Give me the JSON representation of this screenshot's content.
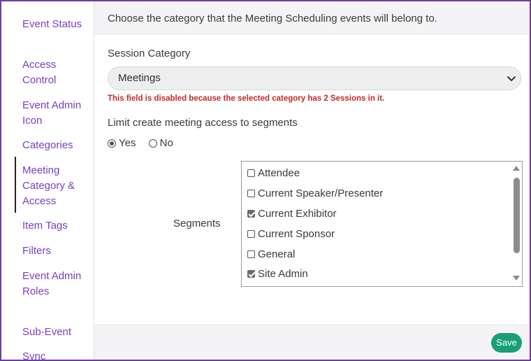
{
  "sidebar": {
    "items": [
      {
        "label": "Event Status"
      },
      {
        "label": "Access Control"
      },
      {
        "label": "Event Admin Icon"
      },
      {
        "label": "Categories"
      },
      {
        "label": "Meeting Category & Access"
      },
      {
        "label": "Item Tags"
      },
      {
        "label": "Filters"
      },
      {
        "label": "Event Admin Roles"
      },
      {
        "label": "Sub-Event"
      },
      {
        "label": "Sync"
      }
    ],
    "active": "Meeting Category & Access"
  },
  "header": {
    "text": "Choose the category that the Meeting Scheduling events will belong to."
  },
  "form": {
    "session_category_label": "Session Category",
    "session_category_value": "Meetings",
    "disabled_message": "This field is disabled because the selected category has 2 Sessions in it.",
    "limit_label": "Limit create meeting access to segments",
    "radio_yes": "Yes",
    "radio_no": "No",
    "radio_selected": "Yes",
    "segments_label": "Segments",
    "segments": [
      {
        "label": "Attendee",
        "checked": false
      },
      {
        "label": "Current Speaker/Presenter",
        "checked": false
      },
      {
        "label": "Current Exhibitor",
        "checked": true
      },
      {
        "label": "Current Sponsor",
        "checked": false
      },
      {
        "label": "General",
        "checked": false
      },
      {
        "label": "Site Admin",
        "checked": true
      }
    ]
  },
  "footer": {
    "save_label": "Save"
  },
  "colors": {
    "accent": "#7a3fc0",
    "frame": "#6b3fa0",
    "error": "#c62828",
    "save": "#1a9e77"
  }
}
